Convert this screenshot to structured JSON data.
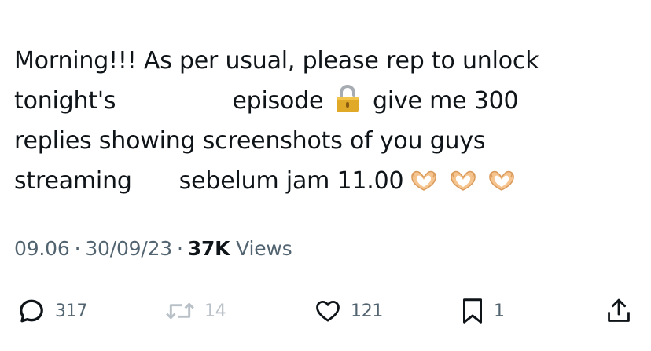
{
  "tweet": {
    "line1": "Morning!!! As per usual, please rep to unlock",
    "line2_a": "tonight's",
    "line2_b": "episode",
    "line2_c": "give me 300",
    "line3": "replies showing screenshots of you guys",
    "line4_a": "streaming",
    "line4_b": "sebelum jam 11.00",
    "emoji_lock": "lock-icon",
    "emoji_hearts": "heart-hands-icon"
  },
  "meta": {
    "time": "09.06",
    "dot": "·",
    "date": "30/09/23",
    "views_count": "37K",
    "views_label": "Views"
  },
  "actions": {
    "reply_count": "317",
    "retweet_count": "14",
    "like_count": "121",
    "bookmark_count": "1"
  },
  "colors": {
    "text": "#0f1419",
    "secondary": "#536471",
    "disabled": "#b9c1c8"
  }
}
